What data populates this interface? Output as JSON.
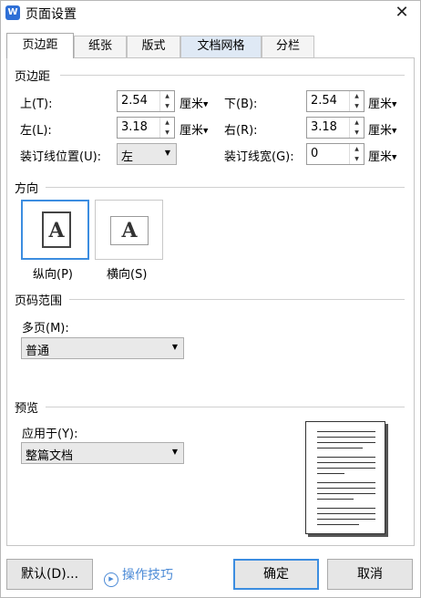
{
  "window": {
    "icon_letter": "W",
    "title": "页面设置",
    "close_glyph": "✕"
  },
  "tabs": [
    {
      "label": "页边距",
      "active": true
    },
    {
      "label": "纸张"
    },
    {
      "label": "版式"
    },
    {
      "label": "文档网格"
    },
    {
      "label": "分栏"
    }
  ],
  "margins": {
    "section_title": "页边距",
    "top": {
      "label": "上(T):",
      "value": "2.54",
      "unit": "厘米"
    },
    "bottom": {
      "label": "下(B):",
      "value": "2.54",
      "unit": "厘米"
    },
    "left": {
      "label": "左(L):",
      "value": "3.18",
      "unit": "厘米"
    },
    "right": {
      "label": "右(R):",
      "value": "3.18",
      "unit": "厘米"
    },
    "gutter_pos": {
      "label": "装订线位置(U):",
      "value": "左"
    },
    "gutter_width": {
      "label": "装订线宽(G):",
      "value": "0",
      "unit": "厘米"
    }
  },
  "orientation": {
    "section_title": "方向",
    "portrait": {
      "label": "纵向(P)",
      "letter": "A",
      "selected": true
    },
    "landscape": {
      "label": "横向(S)",
      "letter": "A"
    }
  },
  "pages": {
    "section_title": "页码范围",
    "multi_label": "多页(M):",
    "multi_value": "普通"
  },
  "preview": {
    "section_title": "预览",
    "apply_label": "应用于(Y):",
    "apply_value": "整篇文档"
  },
  "footer": {
    "default_button": "默认(D)...",
    "tips_link": "操作技巧",
    "ok_button": "确定",
    "cancel_button": "取消"
  },
  "glyphs": {
    "up": "▲",
    "down": "▼",
    "dropdown": "▼",
    "play": "▶"
  },
  "colors": {
    "accent": "#3c8de0",
    "link": "#4b8ad6",
    "brand": "#2e6fd6"
  }
}
